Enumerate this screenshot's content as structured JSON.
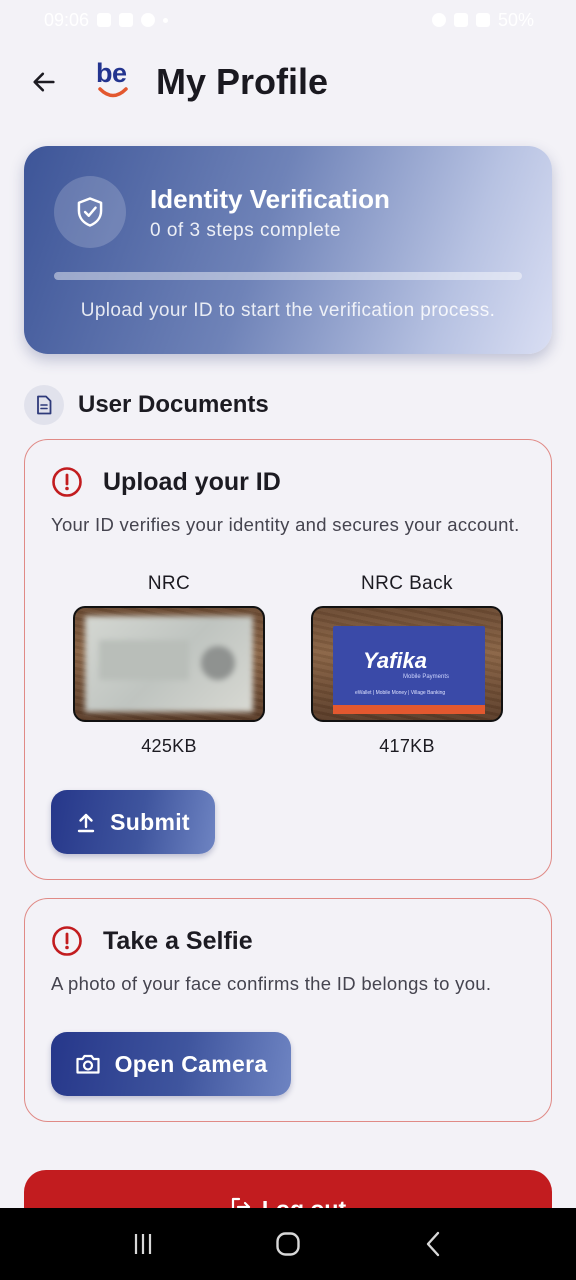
{
  "status_bar": {
    "time": "09:06",
    "battery": "50%"
  },
  "header": {
    "logo_text": "be",
    "title": "My Profile"
  },
  "verification": {
    "title": "Identity Verification",
    "steps": "0 of 3 steps complete",
    "progress": 0,
    "hint": "Upload your ID to start the verification process."
  },
  "documents": {
    "section_title": "User Documents",
    "upload_card": {
      "title": "Upload your ID",
      "description": "Your ID verifies your identity and secures your account.",
      "front": {
        "label": "NRC",
        "size": "425KB"
      },
      "back": {
        "label": "NRC Back",
        "size": "417KB",
        "brand": "afika",
        "brand_prefix": "Y",
        "brand_sub": "Mobile Payments",
        "brand_footer": "eWallet | Mobile Money | Village Banking"
      },
      "submit_label": "Submit"
    },
    "selfie_card": {
      "title": "Take a Selfie",
      "description": "A photo of your face confirms the ID belongs to you.",
      "camera_label": "Open Camera"
    }
  },
  "logout_label": "Log out",
  "colors": {
    "brand_blue": "#26378a",
    "danger_red": "#c21c1f",
    "warning_border": "#e08a86",
    "background": "#f3f2f7"
  }
}
